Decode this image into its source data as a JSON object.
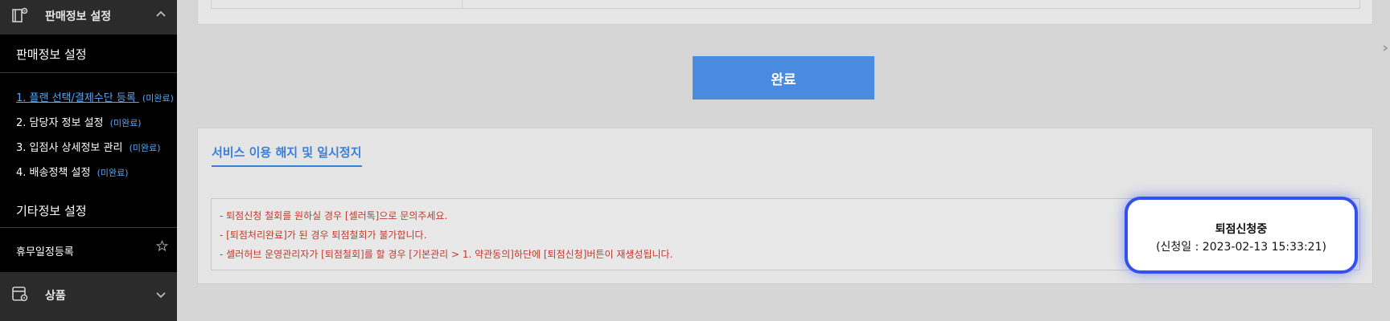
{
  "sidebar": {
    "top_header": {
      "title": "판매정보 설정",
      "icon": "store-settings-icon"
    },
    "section_sales": "판매정보 설정",
    "items": [
      {
        "label": "1. 플랜 선택/결제수단 등록 ",
        "status": "(미완료)"
      },
      {
        "label": "2. 담당자 정보 설정 ",
        "status": "(미완료)"
      },
      {
        "label": "3. 입점사 상세정보 관리 ",
        "status": "(미완료)"
      },
      {
        "label": "4. 배송정책 설정 ",
        "status": "(미완료)"
      }
    ],
    "section_etc": "기타정보 설정",
    "holiday_item": "휴무일정등록",
    "bottom_header": {
      "title": "상품",
      "icon": "product-settings-icon"
    }
  },
  "main": {
    "complete_button": "완료",
    "service_section": {
      "title": "서비스 이용 해지 및 일시정지",
      "notices": [
        "- 퇴점신청 철회를 원하실 경우 [셀러톡]으로 문의주세요.",
        "- [퇴점처리완료]가 된 경우 퇴점철회가 불가합니다.",
        "- 셀러허브 운영관리자가 [퇴점철회]를 할 경우 [기본관리 > 1. 약관동의]하단에 [퇴점신청]버튼이 재생성됩니다."
      ],
      "status_card": {
        "title": "퇴점신청중",
        "date_text": "(신청일 : 2023-02-13 15:33:21)"
      }
    }
  },
  "colors": {
    "accent": "#4a8be0",
    "link": "#5aa6ee",
    "notice_text": "#c0392b",
    "card_border": "#3350f0"
  }
}
